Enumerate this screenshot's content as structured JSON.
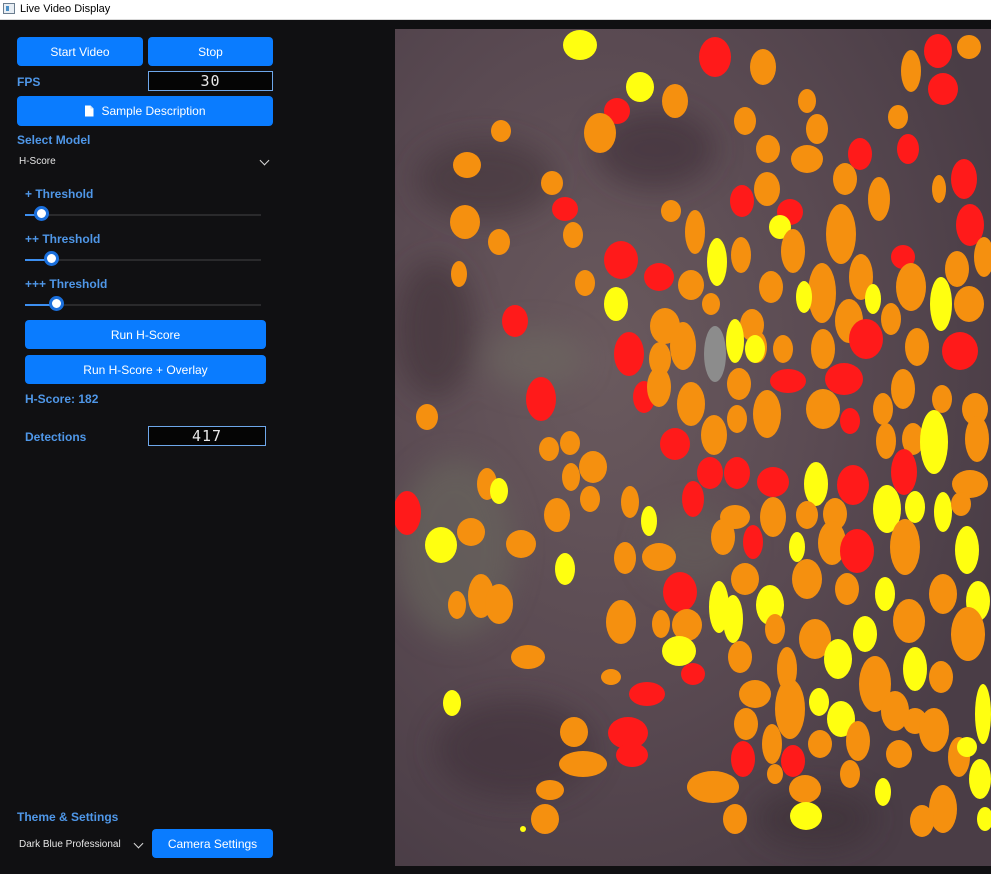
{
  "window": {
    "title": "Live Video Display"
  },
  "controls": {
    "start_label": "Start Video",
    "stop_label": "Stop",
    "fps_label": "FPS",
    "fps_value": "30",
    "sample_label": "Sample Description",
    "select_model_label": "Select Model",
    "model_value": "H-Score",
    "thresholds": [
      {
        "label": "+ Threshold",
        "value": 0.04
      },
      {
        "label": "++ Threshold",
        "value": 0.08
      },
      {
        "label": "+++ Threshold",
        "value": 0.1
      }
    ],
    "run_label": "Run H-Score",
    "run_overlay_label": "Run H-Score + Overlay",
    "hscore_text": "H-Score: 182",
    "detections_label": "Detections",
    "detections_value": "417",
    "theme_section_label": "Theme & Settings",
    "theme_value": "Dark Blue Professional",
    "camera_label": "Camera Settings"
  },
  "colors": {
    "accent": "#0a7cff",
    "label": "#4f97e8",
    "background": "#101012",
    "detection_red": "#ff1a1a",
    "detection_orange": "#f5900f",
    "detection_yellow": "#ffff10",
    "detection_gray": "#8c8c8c"
  },
  "icons": {
    "sample": "document-icon",
    "model_dropdown": "chevron-down-icon",
    "theme_dropdown": "chevron-down-icon"
  }
}
